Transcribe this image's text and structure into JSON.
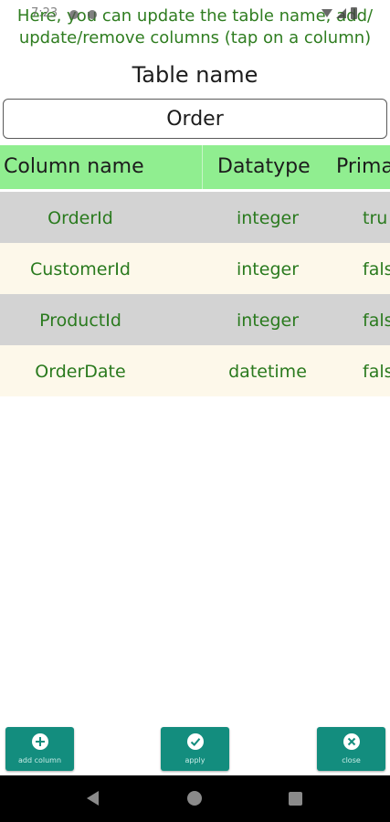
{
  "status_bar": {
    "time": "7:23"
  },
  "hint": {
    "line1": "Here, you can update the table name, add/",
    "line2": "update/remove columns (tap on a column)"
  },
  "title": "Table name",
  "table_name_input": {
    "value": "Order"
  },
  "columns_table": {
    "headers": [
      "Column name",
      "Datatype",
      "Prima"
    ],
    "rows": [
      {
        "name": "OrderId",
        "datatype": "integer",
        "primary_key": "tru"
      },
      {
        "name": "CustomerId",
        "datatype": "integer",
        "primary_key": "fals"
      },
      {
        "name": "ProductId",
        "datatype": "integer",
        "primary_key": "fals"
      },
      {
        "name": "OrderDate",
        "datatype": "datetime",
        "primary_key": "fals"
      }
    ]
  },
  "buttons": {
    "add_column": {
      "label": "add column",
      "icon": "plus-circle-icon"
    },
    "apply": {
      "label": "apply",
      "icon": "check-circle-icon"
    },
    "close": {
      "label": "close",
      "icon": "x-circle-icon"
    }
  },
  "colors": {
    "header_bg": "#90ee90",
    "row_gray": "#d3d3d3",
    "row_cream": "#fdf8ea",
    "text_green": "#2a7a1e",
    "button_teal": "#138d7e"
  }
}
